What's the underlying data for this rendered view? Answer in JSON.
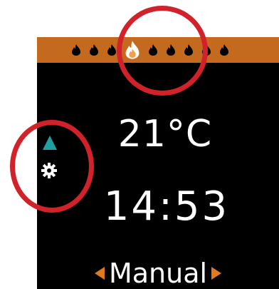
{
  "display": {
    "temperature": "21°C",
    "time": "14:53",
    "mode": "Manual"
  },
  "flame_bar": {
    "flame_count": 9,
    "active_flame_index": 3,
    "colors": {
      "bar": "#c46a1f",
      "flame": "#000000",
      "active_flame": "#ffffff",
      "active_flame_inner": "#f2a04a"
    }
  },
  "side_icons": [
    "up-triangle-icon",
    "gear-icon"
  ],
  "colors": {
    "screen_bg": "#000000",
    "text": "#ffffff",
    "accent_orange": "#e07a1f",
    "accent_teal": "#1f9fa0",
    "annotation_circle": "#d1222a"
  }
}
